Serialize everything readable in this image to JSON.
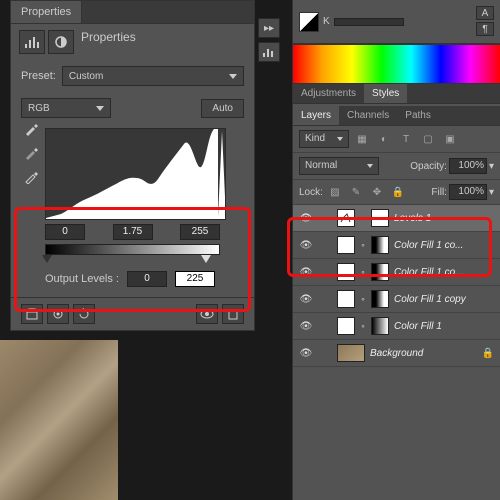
{
  "properties": {
    "tab": "Properties",
    "preset_label": "Preset:",
    "preset_value": "Custom",
    "channel": "RGB",
    "auto": "Auto",
    "input": {
      "black": "0",
      "mid": "1.75",
      "white": "255"
    },
    "output_label": "Output Levels :",
    "output_black": "0",
    "output_white": "225"
  },
  "right": {
    "k_label": "K",
    "tabs_mid": {
      "adjustments": "Adjustments",
      "styles": "Styles"
    },
    "tabs_lay": {
      "layers": "Layers",
      "channels": "Channels",
      "paths": "Paths"
    },
    "kind": "Kind",
    "blend": "Normal",
    "opacity_label": "Opacity:",
    "opacity": "100%",
    "lock_label": "Lock:",
    "fill_label": "Fill:",
    "fill": "100%",
    "layers": [
      {
        "name": "Levels 1"
      },
      {
        "name": "Color Fill 1 co..."
      },
      {
        "name": "Color Fill 1 co..."
      },
      {
        "name": "Color Fill 1 copy"
      },
      {
        "name": "Color Fill 1"
      },
      {
        "name": "Background"
      }
    ]
  }
}
